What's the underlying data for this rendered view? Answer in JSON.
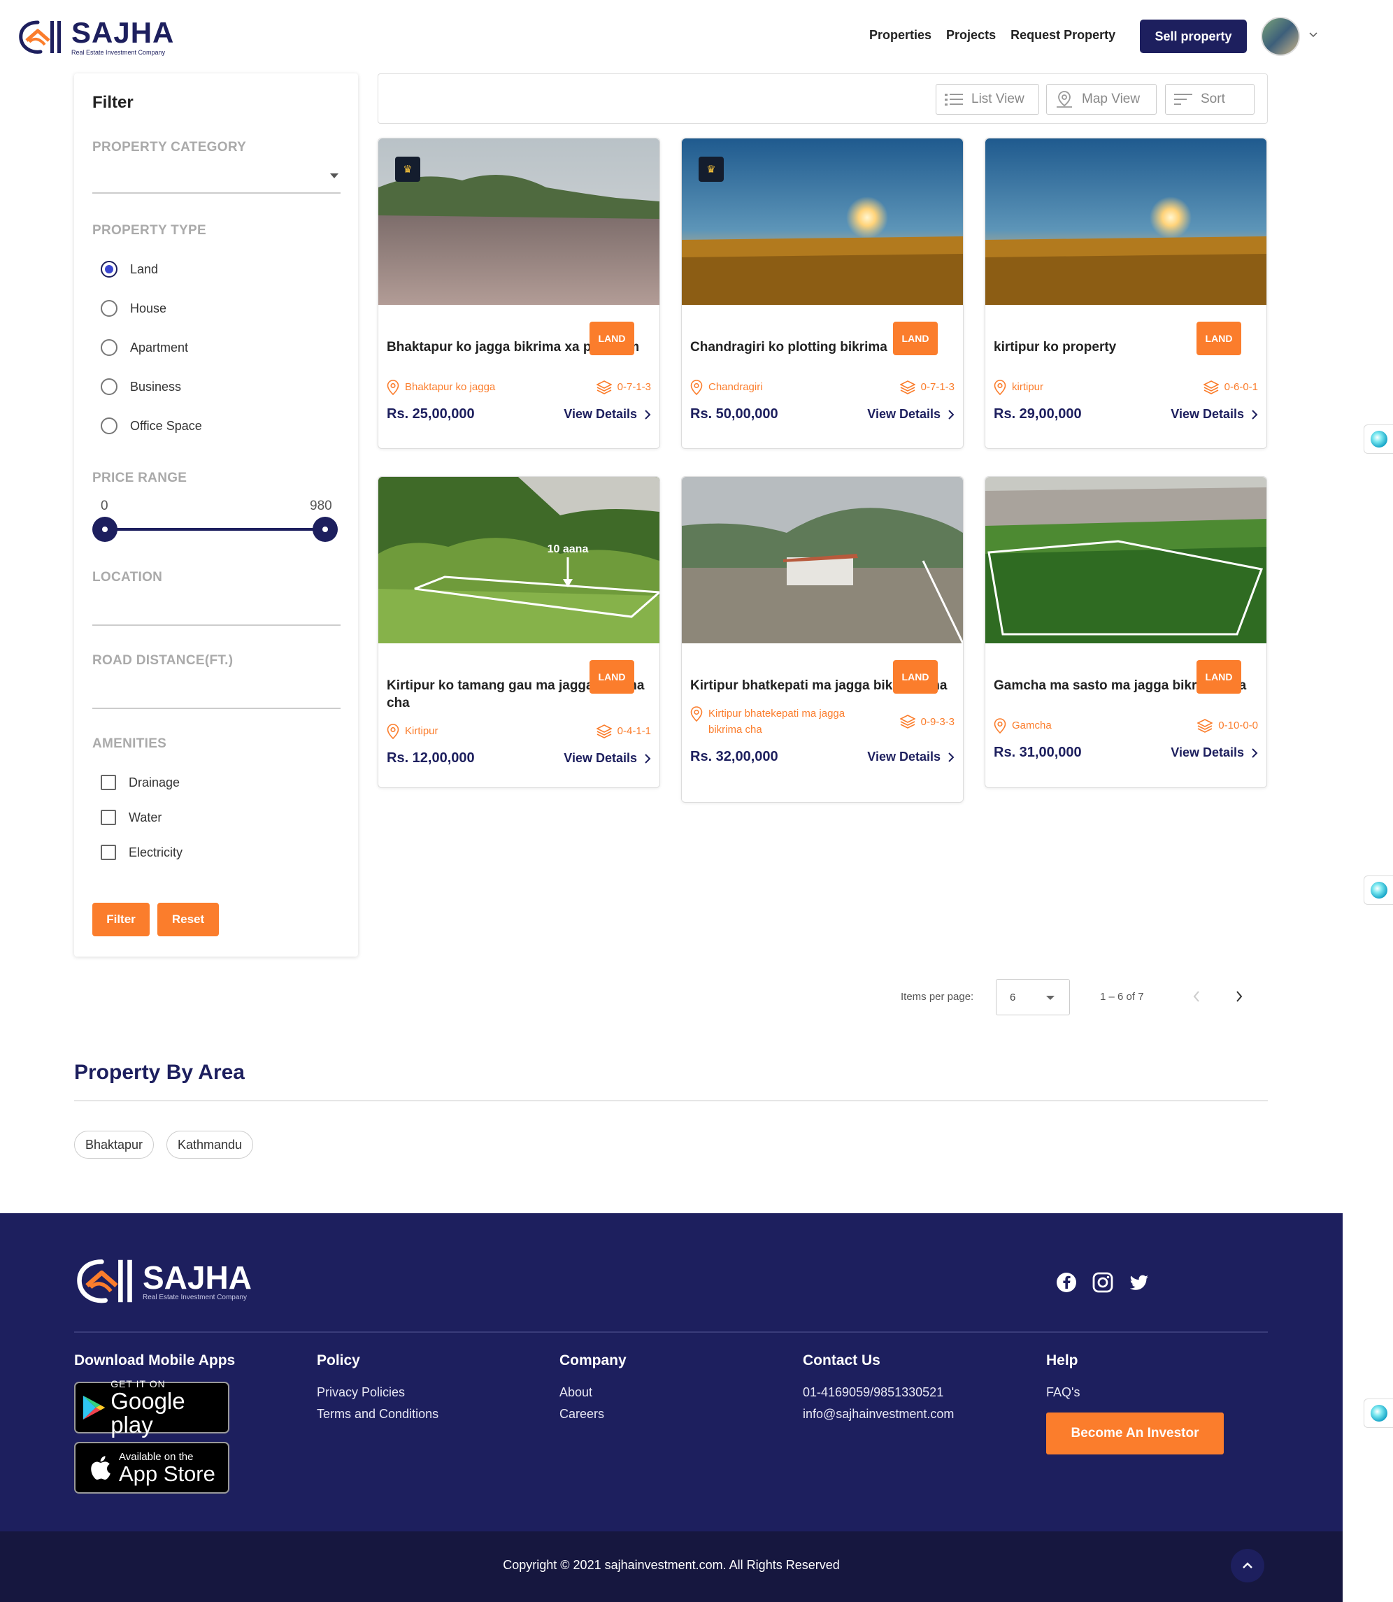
{
  "brand": {
    "name": "SAJHA",
    "tagline": "Real Estate Investment Company"
  },
  "nav": {
    "links": [
      "Properties",
      "Projects",
      "Request Property"
    ],
    "sell_button": "Sell property"
  },
  "filter": {
    "title": "Filter",
    "category_label": "PROPERTY CATEGORY",
    "type_label": "PROPERTY TYPE",
    "types": [
      "Land",
      "House",
      "Apartment",
      "Business",
      "Office Space"
    ],
    "selected_type": "Land",
    "price_label": "PRICE RANGE",
    "price_min": "0",
    "price_max": "980",
    "location_label": "LOCATION",
    "road_label": "ROAD DISTANCE(FT.)",
    "amenities_label": "AMENITIES",
    "amenities": [
      "Drainage",
      "Water",
      "Electricity"
    ],
    "filter_button": "Filter",
    "reset_button": "Reset"
  },
  "toolbar": {
    "list_view": "List View",
    "map_view": "Map View",
    "sort": "Sort"
  },
  "listings": [
    {
      "title": "Bhaktapur ko jagga bikrima xa premium",
      "badge": "LAND",
      "location": "Bhaktapur ko jagga",
      "area": "0-7-1-3",
      "price": "Rs. 25,00,000",
      "details": "View Details",
      "premium": true
    },
    {
      "title": "Chandragiri ko plotting bikrima",
      "badge": "LAND",
      "location": "Chandragiri",
      "area": "0-7-1-3",
      "price": "Rs. 50,00,000",
      "details": "View Details",
      "premium": true
    },
    {
      "title": "kirtipur ko property",
      "badge": "LAND",
      "location": "kirtipur",
      "area": "0-6-0-1",
      "price": "Rs. 29,00,000",
      "details": "View Details",
      "premium": false
    },
    {
      "title": "Kirtipur ko tamang gau ma jagga bikrima cha",
      "badge": "LAND",
      "location": "Kirtipur",
      "area": "0-4-1-1",
      "price": "Rs. 12,00,000",
      "details": "View Details",
      "premium": false,
      "image_text": "10 aana"
    },
    {
      "title": "Kirtipur bhatkepati ma jagga bikrima cha",
      "badge": "LAND",
      "location": "Kirtipur bhatekepati ma jagga bikrima cha",
      "area": "0-9-3-3",
      "price": "Rs. 32,00,000",
      "details": "View Details",
      "premium": false
    },
    {
      "title": "Gamcha ma sasto ma jagga bikrima cha",
      "badge": "LAND",
      "location": "Gamcha",
      "area": "0-10-0-0",
      "price": "Rs. 31,00,000",
      "details": "View Details",
      "premium": false
    }
  ],
  "pagination": {
    "label": "Items per page:",
    "per_page": "6",
    "range": "1 – 6 of 7"
  },
  "area_section": {
    "title": "Property By Area",
    "areas": [
      "Bhaktapur",
      "Kathmandu"
    ]
  },
  "footer": {
    "apps_title": "Download Mobile Apps",
    "google_top": "GET IT ON",
    "google_bottom": "Google play",
    "apple_top": "Available on the",
    "apple_bottom": "App Store",
    "policy_title": "Policy",
    "policy_links": [
      "Privacy Policies",
      "Terms and Conditions"
    ],
    "company_title": "Company",
    "company_links": [
      "About",
      "Careers"
    ],
    "contact_title": "Contact Us",
    "phone": "01-4169059/9851330521",
    "email": "info@sajhainvestment.com",
    "help_title": "Help",
    "faq": "FAQ's",
    "investor_button": "Become An Investor",
    "copyright": "Copyright © 2021 sajhainvestment.com. All Rights Reserved"
  },
  "colors": {
    "primary": "#1d1f5e",
    "accent": "#fb7d2c"
  }
}
